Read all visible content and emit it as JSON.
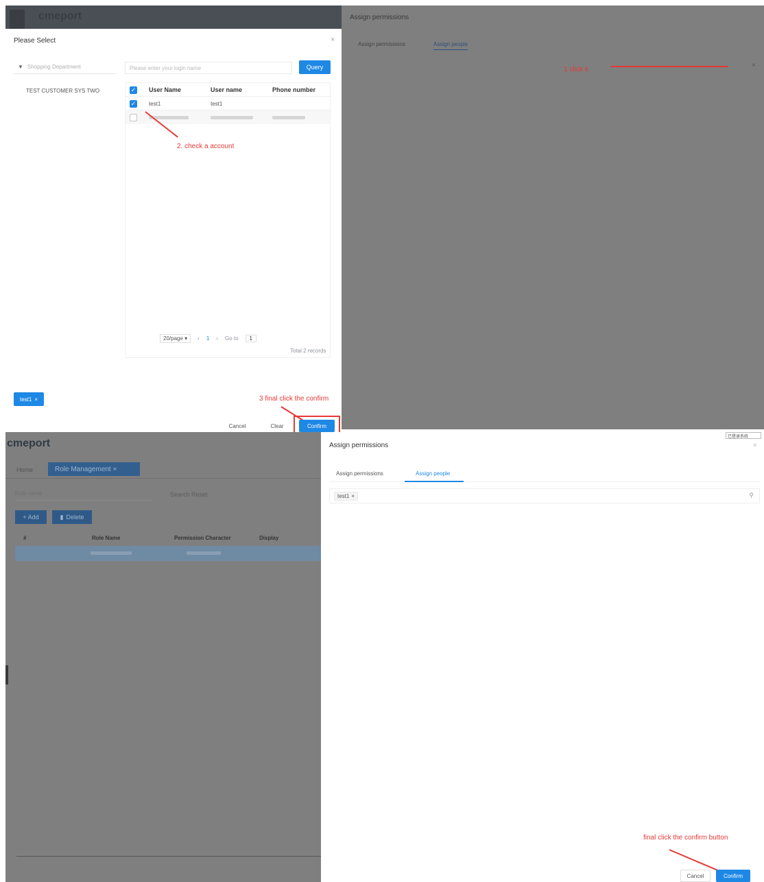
{
  "top": {
    "app_title": "cmeport",
    "dialog": {
      "title": "Please Select",
      "close": "×",
      "dept_placeholder": "Shopping Department",
      "search_placeholder": "Please enter your login name",
      "query_label": "Query",
      "tree_node": "TEST CUSTOMER SYS TWO",
      "columns": [
        "User Name",
        "User name",
        "Phone number"
      ],
      "rows": [
        {
          "checked": true,
          "user_name": "test1",
          "login_name": "test1",
          "phone": ""
        }
      ],
      "page_size": "20/page",
      "page_current": "1",
      "goto_label": "Go to",
      "goto_value": "1",
      "total": "Total 2 records",
      "selected_tag": "test1",
      "cancel_label": "Cancel",
      "clear_label": "Clear",
      "confirm_label": "Confirm"
    },
    "side": {
      "title": "Assign permissions",
      "tabs": [
        "Assign permissions",
        "Assign people"
      ]
    },
    "annotations": {
      "step1": "1 click it",
      "step2": "2. check a account",
      "step3": "3 final click the confirm"
    }
  },
  "bottom": {
    "app_title": "cmeport",
    "breadcrumb": [
      "Home",
      "Role Management ×"
    ],
    "role_name_placeholder": "Role name",
    "search_reset": "Search  Reset",
    "add_label": "+ Add",
    "delete_label": "Delete",
    "columns": [
      "#",
      "Role Name",
      "Permission Character",
      "Display"
    ],
    "panel": {
      "title": "Assign permissions",
      "close": "×",
      "tabs": [
        "Assign permissions",
        "Assign people"
      ],
      "selected_tag": "test1",
      "cancel_label": "Cancel",
      "confirm_label": "Confirm"
    },
    "annotation_final": "final click the confirm button",
    "corner_badge": "已登录系统"
  },
  "colors": {
    "accent": "#1e88e5",
    "overlay": "#7f7f7f",
    "annotation": "#e53935"
  }
}
